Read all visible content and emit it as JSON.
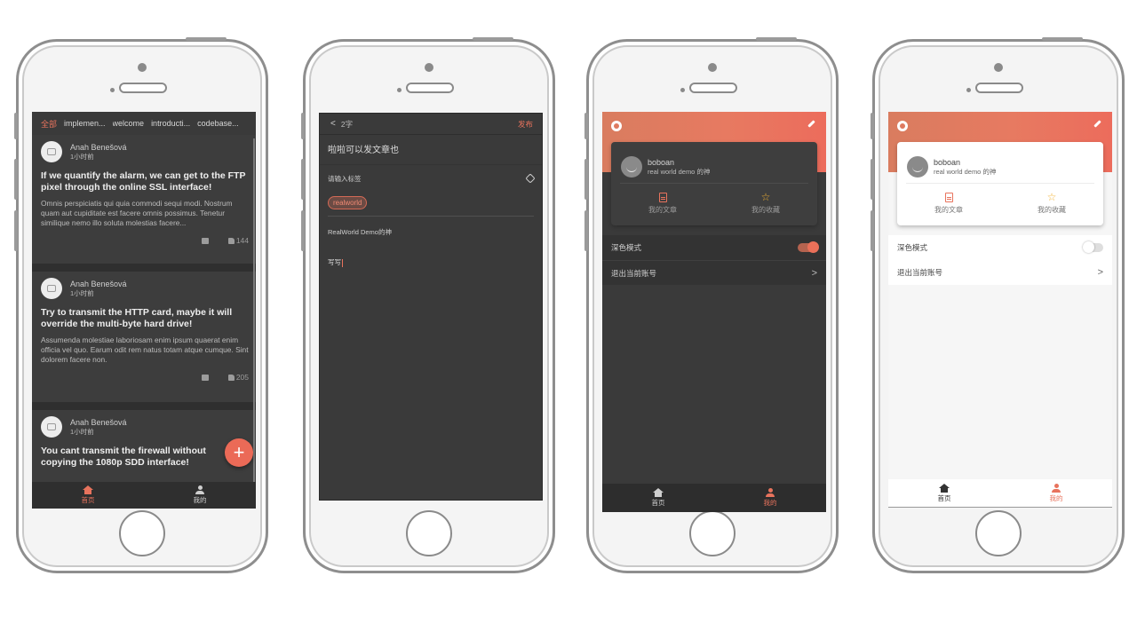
{
  "feed": {
    "tabs": [
      "全部",
      "implemen...",
      "welcome",
      "introducti...",
      "codebase..."
    ],
    "articles": [
      {
        "author": "Anah Benešová",
        "time": "1小时前",
        "title": "If we quantify the alarm, we can get to the FTP pixel through the online SSL interface!",
        "excerpt": "Omnis perspiciatis qui quia commodi sequi modi. Nostrum quam aut cupiditate est facere omnis possimus. Tenetur similique nemo illo soluta molestias facere...",
        "likes": "144"
      },
      {
        "author": "Anah Benešová",
        "time": "1小时前",
        "title": "Try to transmit the HTTP card, maybe it will override the multi-byte hard drive!",
        "excerpt": "Assumenda molestiae laboriosam enim ipsum quaerat enim officia vel quo. Earum odit rem natus totam atque cumque. Sint dolorem facere non.",
        "likes": "205"
      },
      {
        "author": "Anah Benešová",
        "time": "1小时前",
        "title": "You cant transmit the firewall without copying the 1080p SDD interface!"
      }
    ],
    "fab": "+"
  },
  "nav": {
    "home": "首页",
    "mine": "我的"
  },
  "editor": {
    "back": "<",
    "word_count": "2字",
    "publish": "发布",
    "title": "啦啦可以发文章也",
    "tags_label": "请输入标签",
    "tag": "realworld",
    "description": "RealWorld Demo的神",
    "body": "写写"
  },
  "profile": {
    "username": "boboan",
    "bio": "real world demo 的神",
    "my_articles": "我的文章",
    "my_favorites": "我的收藏",
    "dark_mode": "深色模式",
    "logout": "退出当前账号",
    "chevron": ">"
  },
  "colors": {
    "accent": "#e8735d",
    "dark_bg": "#2f2f2f",
    "star": "#f2b233"
  },
  "icons": [
    "github-icon",
    "edit-icon",
    "home-icon",
    "user-icon",
    "document-icon",
    "star-icon",
    "comment-icon",
    "thumb-up-icon",
    "tag-icon",
    "chevron-right-icon"
  ]
}
